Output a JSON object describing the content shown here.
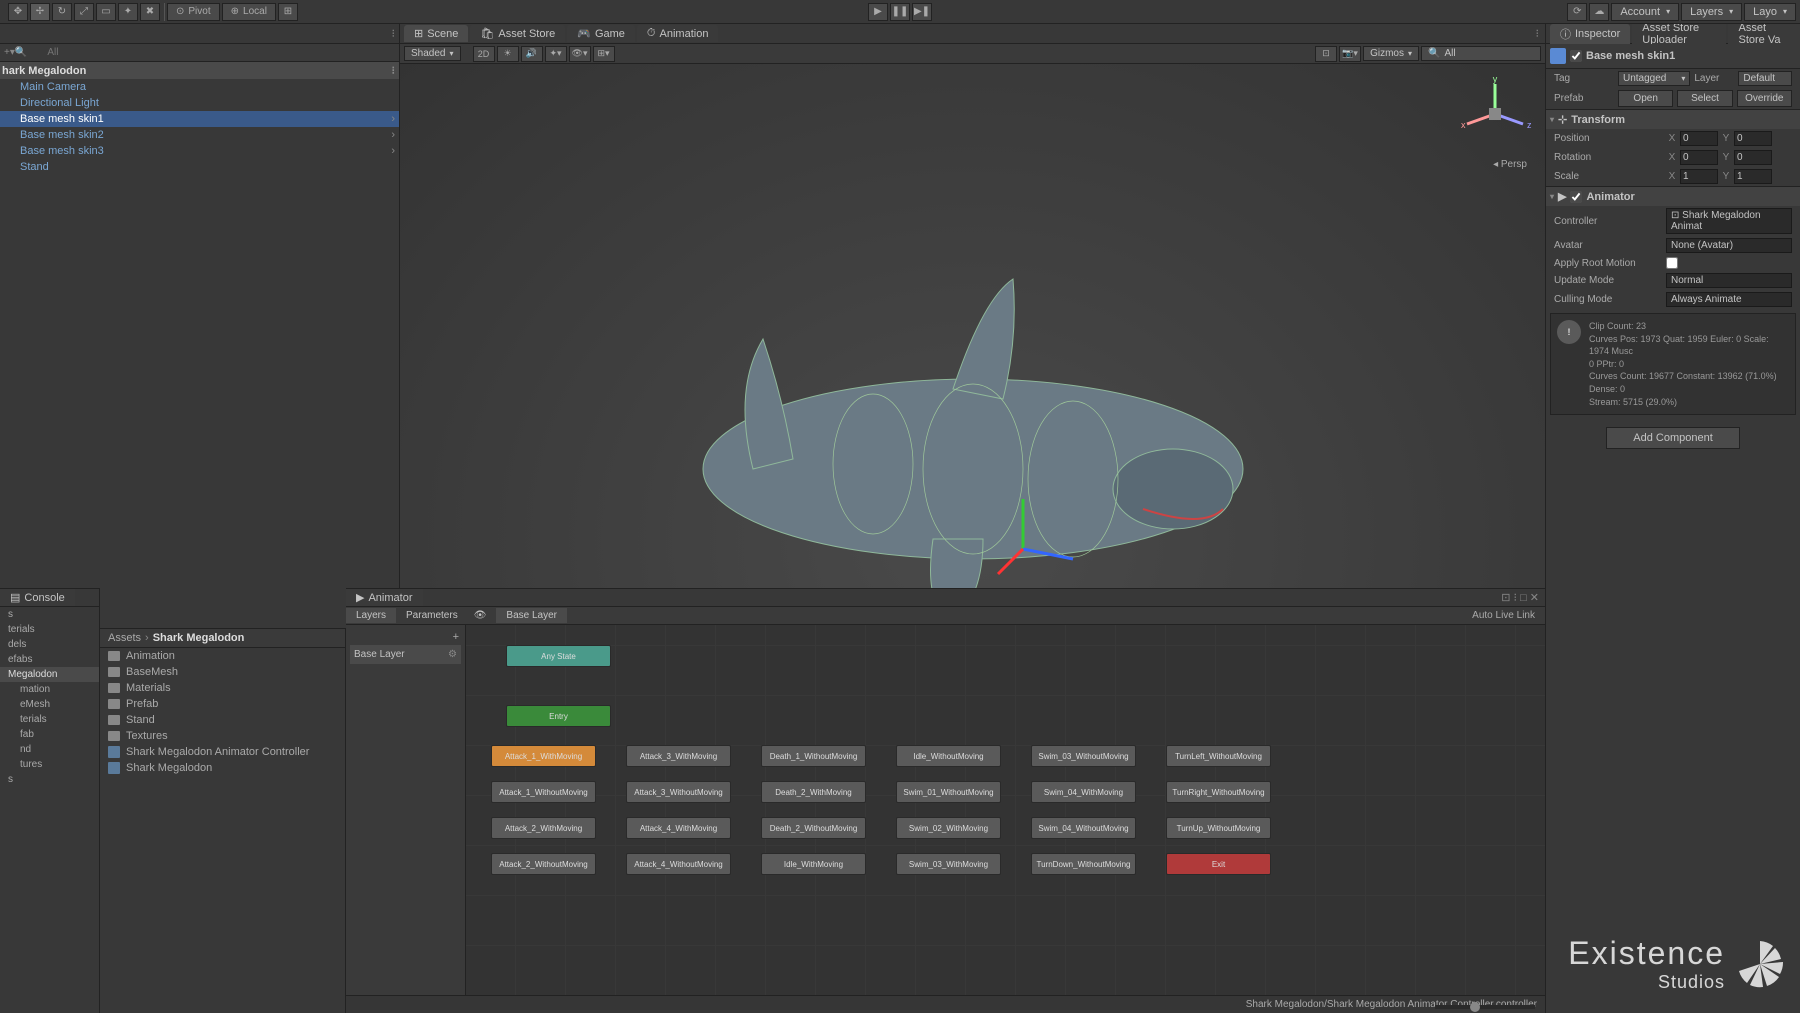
{
  "toolbar": {
    "pivot": "Pivot",
    "local": "Local",
    "account": "Account",
    "layers": "Layers",
    "layout": "Layo"
  },
  "hierarchy": {
    "search_placeholder": "All",
    "scene": "hark Megalodon",
    "items": [
      "Main Camera",
      "Directional Light",
      "Base mesh skin1",
      "Base mesh skin2",
      "Base mesh skin3",
      "Stand"
    ]
  },
  "scene_tabs": {
    "scene": "Scene",
    "asset_store": "Asset Store",
    "game": "Game",
    "animation": "Animation"
  },
  "scene_tb": {
    "shaded": "Shaded",
    "mode2d": "2D",
    "gizmos": "Gizmos",
    "search_all": "All",
    "persp": "Persp"
  },
  "inspector": {
    "tabs": {
      "inspector": "Inspector",
      "uploader": "Asset Store Uploader",
      "validator": "Asset Store Va"
    },
    "name": "Base mesh skin1",
    "tag_label": "Tag",
    "tag_value": "Untagged",
    "layer_label": "Layer",
    "layer_value": "Default",
    "prefab_label": "Prefab",
    "open": "Open",
    "select": "Select",
    "overrides": "Override",
    "transform": {
      "title": "Transform",
      "position": "Position",
      "rotation": "Rotation",
      "scale": "Scale",
      "pos": {
        "x": "0",
        "y": "0"
      },
      "rot": {
        "x": "0",
        "y": "0"
      },
      "scl": {
        "x": "1",
        "y": "1"
      }
    },
    "animator": {
      "title": "Animator",
      "controller_label": "Controller",
      "controller_value": "Shark Megalodon Animat",
      "avatar_label": "Avatar",
      "avatar_value": "None (Avatar)",
      "root_motion": "Apply Root Motion",
      "update_mode_label": "Update Mode",
      "update_mode_value": "Normal",
      "culling_label": "Culling Mode",
      "culling_value": "Always Animate",
      "info1": "Clip Count: 23",
      "info2": "Curves Pos: 1973 Quat: 1959 Euler: 0 Scale: 1974 Musc",
      "info3": "0 PPtr: 0",
      "info4": "Curves Count: 19677 Constant: 13962 (71.0%) Dense: 0",
      "info5": "Stream: 5715 (29.0%)"
    },
    "add_component": "Add Component"
  },
  "console": {
    "title": "Console"
  },
  "project": {
    "tree": [
      "s",
      "terials",
      "dels",
      "efabs",
      "Megalodon",
      "mation",
      "eMesh",
      "terials",
      "fab",
      "nd",
      "tures",
      "s"
    ],
    "breadcrumb": {
      "root": "Assets",
      "current": "Shark Megalodon"
    },
    "items": [
      {
        "type": "folder",
        "name": "Animation"
      },
      {
        "type": "folder",
        "name": "BaseMesh"
      },
      {
        "type": "folder",
        "name": "Materials"
      },
      {
        "type": "folder",
        "name": "Prefab"
      },
      {
        "type": "folder",
        "name": "Stand"
      },
      {
        "type": "folder",
        "name": "Textures"
      },
      {
        "type": "asset",
        "name": "Shark Megalodon Animator Controller"
      },
      {
        "type": "asset",
        "name": "Shark Megalodon"
      }
    ]
  },
  "animator": {
    "title": "Animator",
    "tabs": {
      "layers": "Layers",
      "parameters": "Parameters"
    },
    "crumb": "Base Layer",
    "live_link": "Auto Live Link",
    "layer_name": "Base Layer",
    "nodes": {
      "any": "Any State",
      "entry": "Entry",
      "exit": "Exit",
      "row1": [
        "Attack_1_WithMoving",
        "Attack_3_WithMoving",
        "Death_1_WithoutMoving",
        "Idle_WithoutMoving",
        "Swim_03_WithoutMoving",
        "TurnLeft_WithoutMoving"
      ],
      "row2": [
        "Attack_1_WithoutMoving",
        "Attack_3_WithoutMoving",
        "Death_2_WithMoving",
        "Swim_01_WithoutMoving",
        "Swim_04_WithMoving",
        "TurnRight_WithoutMoving"
      ],
      "row3": [
        "Attack_2_WithMoving",
        "Attack_4_WithMoving",
        "Death_2_WithoutMoving",
        "Swim_02_WithMoving",
        "Swim_04_WithoutMoving",
        "TurnUp_WithoutMoving"
      ],
      "row4": [
        "Attack_2_WithoutMoving",
        "Attack_4_WithoutMoving",
        "Idle_WithMoving",
        "Swim_03_WithMoving",
        "TurnDown_WithoutMoving"
      ]
    },
    "footer": "Shark Megalodon/Shark Megalodon Animator Controller.controller"
  },
  "watermark": {
    "main": "Existence",
    "sub": "Studios"
  }
}
